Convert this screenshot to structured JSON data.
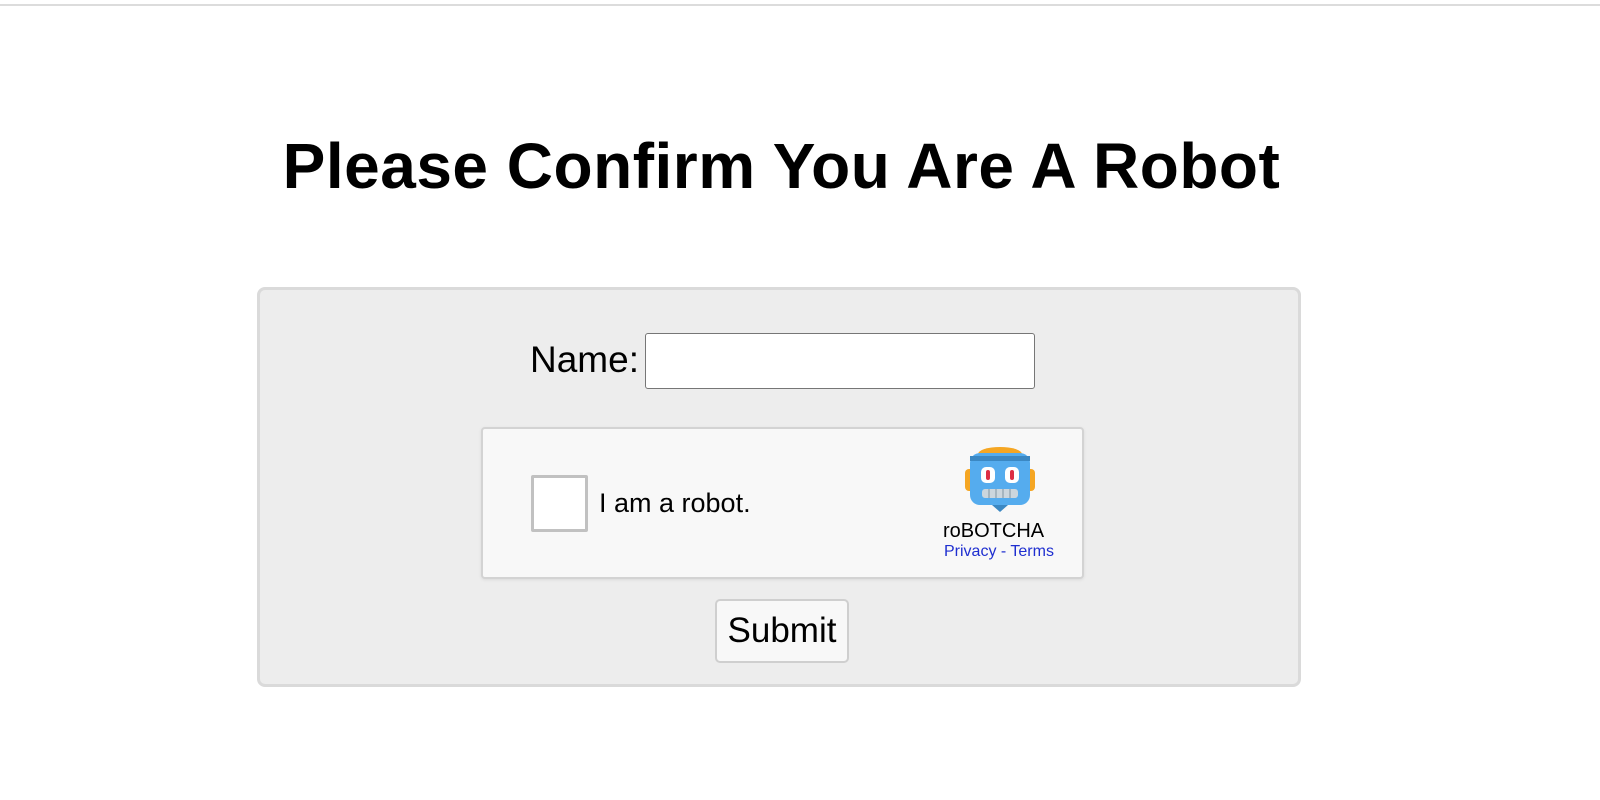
{
  "page": {
    "title": "Please Confirm You Are A Robot"
  },
  "form": {
    "name_label": "Name:",
    "name_value": "",
    "submit_label": "Submit"
  },
  "captcha": {
    "checkbox_label": "I am a robot.",
    "checked": false,
    "brand": "roBOTCHA",
    "privacy_link": "Privacy",
    "separator": " - ",
    "terms_link": "Terms",
    "icon": "robot-face-icon"
  },
  "colors": {
    "link": "#1f2fd0",
    "panel_bg": "#ededed",
    "captcha_bg": "#f8f8f8"
  }
}
